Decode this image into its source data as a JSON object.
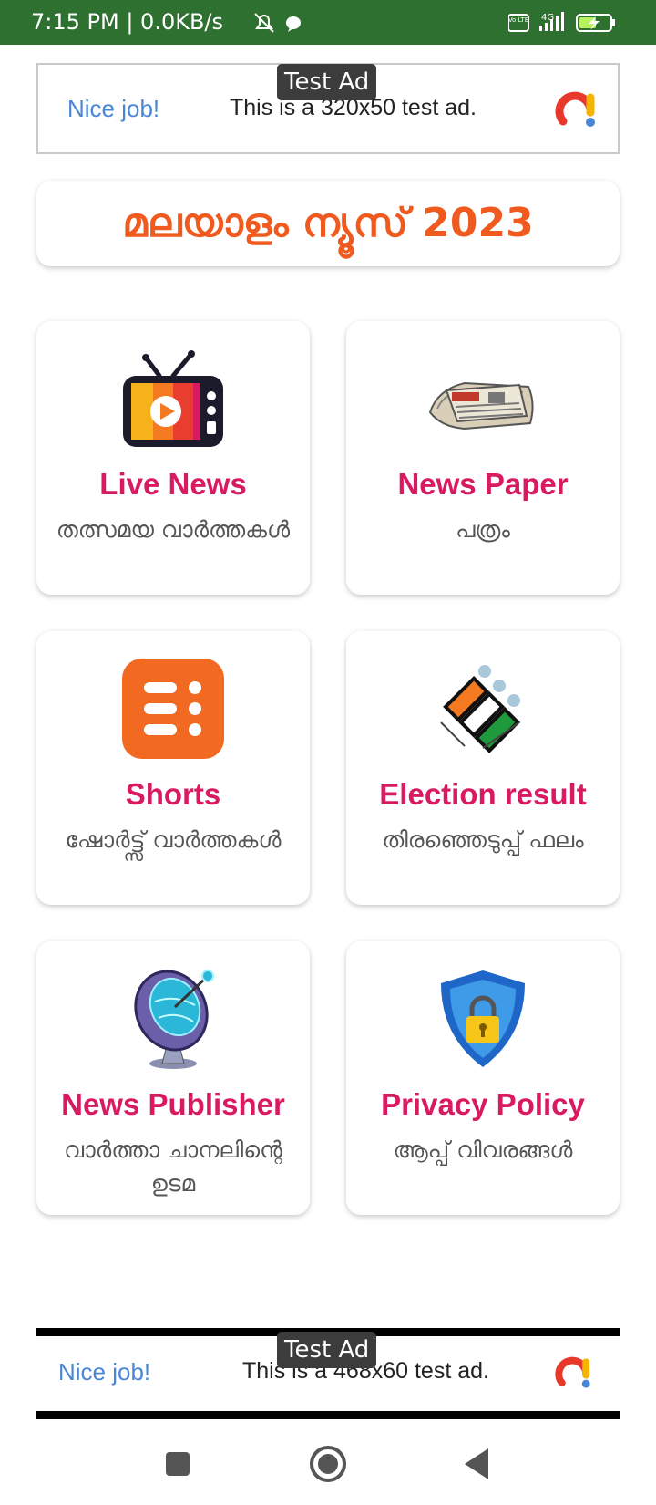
{
  "status_bar": {
    "text": "7:15 PM | 0.0KB/s",
    "icons": [
      "mute-icon",
      "chat-bubble-icon",
      "volte-icon",
      "signal-4g-icon",
      "battery-charging-icon"
    ],
    "network": "4G",
    "volte": "Vo LTE"
  },
  "ad_top": {
    "badge": "Test Ad",
    "nice": "Nice job!",
    "description": "This is a 320x50 test ad."
  },
  "title": {
    "text": "മലയാളം ന്യൂസ് 2023",
    "color": "#f05a1e"
  },
  "cards": [
    {
      "title": "Live News",
      "subtitle": "തത്സമയ വാർത്തകൾ",
      "icon": "tv-icon"
    },
    {
      "title": "News Paper",
      "subtitle": "പത്രം",
      "icon": "newspaper-icon"
    },
    {
      "title": "Shorts",
      "subtitle": "ഷോർട്ട്സ് വാർത്തകൾ",
      "icon": "shorts-icon"
    },
    {
      "title": "Election result",
      "subtitle": "തിരഞ്ഞെടുപ്പ് ഫലം",
      "icon": "election-commission-icon"
    },
    {
      "title": "News Publisher",
      "subtitle": "വാർത്താ ചാനലിന്റെ ഉടമ",
      "icon": "satellite-dish-icon"
    },
    {
      "title": "Privacy Policy",
      "subtitle": "ആപ്പ് വിവരങ്ങൾ",
      "icon": "shield-lock-icon"
    }
  ],
  "ad_bottom": {
    "badge": "Test Ad",
    "nice": "Nice job!",
    "description": "This is a 468x60 test ad."
  },
  "nav": {
    "icons": [
      "recent-apps-icon",
      "home-icon",
      "back-icon"
    ]
  },
  "colors": {
    "status_bar": "#2e7030",
    "card_title": "#d81b60",
    "ad_nice": "#4a86d6"
  }
}
